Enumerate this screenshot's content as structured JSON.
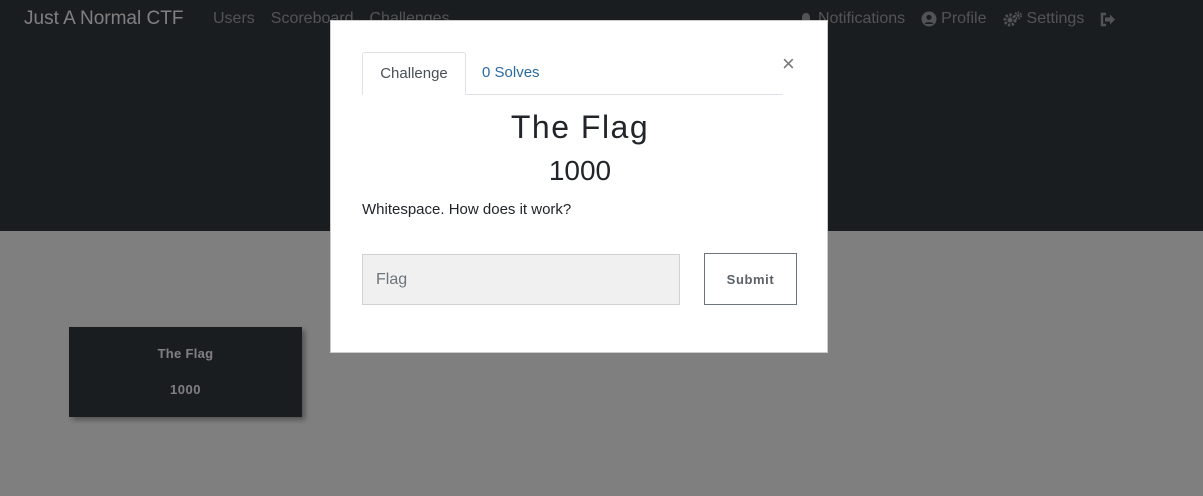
{
  "navbar": {
    "brand": "Just A Normal CTF",
    "links": [
      "Users",
      "Scoreboard",
      "Challenges"
    ],
    "right": [
      {
        "label": "Notifications",
        "icon": "bell-icon"
      },
      {
        "label": "Profile",
        "icon": "user-circle-icon"
      },
      {
        "label": "Settings",
        "icon": "cogs-icon"
      },
      {
        "label": "",
        "icon": "sign-out-icon"
      }
    ]
  },
  "board": {
    "card": {
      "name": "The Flag",
      "value": "1000"
    }
  },
  "modal": {
    "tabs": {
      "challenge": "Challenge",
      "solves": "0 Solves"
    },
    "close": "×",
    "title": "The Flag",
    "points": "1000",
    "description": "Whitespace. How does it work?",
    "flag_placeholder": "Flag",
    "submit_label": "Submit"
  },
  "colors": {
    "dark": "#343a40",
    "backdrop": "rgba(0,0,0,0.5)",
    "link": "#2b6aa0"
  }
}
